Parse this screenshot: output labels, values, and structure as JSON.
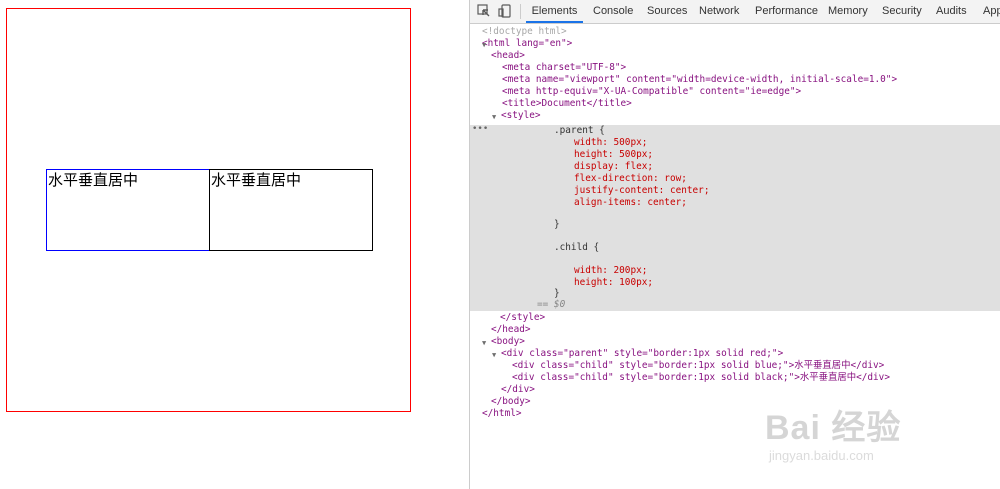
{
  "page": {
    "child1_text": "水平垂直居中",
    "child2_text": "水平垂直居中"
  },
  "devtools": {
    "tabs": [
      {
        "label": "Elements",
        "active": true
      },
      {
        "label": "Console"
      },
      {
        "label": "Sources"
      },
      {
        "label": "Network"
      },
      {
        "label": "Performance"
      },
      {
        "label": "Memory"
      },
      {
        "label": "Security"
      },
      {
        "label": "Audits"
      },
      {
        "label": "App"
      }
    ],
    "code": {
      "doctype": "<!doctype html>",
      "html_open": "<html lang=\"en\">",
      "head_open": "<head>",
      "meta_charset": "<meta charset=\"UTF-8\">",
      "meta_viewport": "<meta name=\"viewport\" content=\"width=device-width, initial-scale=1.0\">",
      "meta_compat": "<meta http-equiv=\"X-UA-Compatible\" content=\"ie=edge\">",
      "title": "<title>Document</title>",
      "style_open": "<style>",
      "css_parent_sel": ".parent {",
      "css_width": "width: 500px;",
      "css_height": "height: 500px;",
      "css_display": "display: flex;",
      "css_flexdir": "flex-direction: row;",
      "css_justify": "justify-content: center;",
      "css_align": "align-items: center;",
      "css_close1": "}",
      "css_child_sel": ".child {",
      "css_cwidth": "width: 200px;",
      "css_cheight": "height: 100px;",
      "css_close2": "}",
      "eq_sel": "== $0",
      "style_close": "</style>",
      "head_close": "</head>",
      "body_open": "<body>",
      "div_parent": "<div class=\"parent\" style=\"border:1px solid red;\">",
      "div_child1": "<div class=\"child\" style=\"border:1px solid blue;\">水平垂直居中</div>",
      "div_child2": "<div class=\"child\" style=\"border:1px solid black;\">水平垂直居中</div>",
      "div_close": "</div>",
      "body_close": "</body>",
      "html_close": "</html>"
    }
  },
  "watermark": {
    "main": "Bai 经验",
    "sub": "jingyan.baidu.com"
  }
}
